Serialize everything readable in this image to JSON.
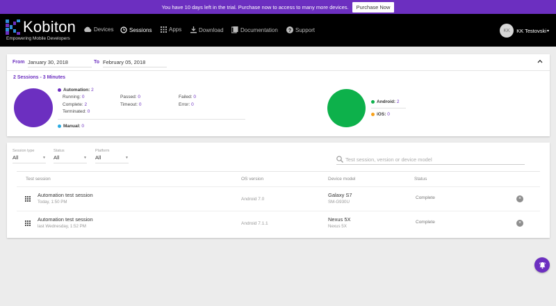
{
  "trial": {
    "message": "You have 10 days left in the trial. Purchase now to access to many more devices.",
    "button": "Purchase Now"
  },
  "brand": {
    "name": "Kobiton",
    "tagline": "Empowering Mobile Developers"
  },
  "nav": {
    "items": [
      {
        "label": "Devices",
        "icon": "cloud-icon"
      },
      {
        "label": "Sessions",
        "icon": "clock-icon",
        "active": true
      },
      {
        "label": "Apps",
        "icon": "grid-icon"
      },
      {
        "label": "Download",
        "icon": "download-icon"
      },
      {
        "label": "Documentation",
        "icon": "book-icon"
      },
      {
        "label": "Support",
        "icon": "help-icon"
      }
    ],
    "user": {
      "initials": "KK",
      "name": "KK Testovski"
    }
  },
  "date_range": {
    "from_label": "From",
    "from": "January 30, 2018",
    "to_label": "To",
    "to": "February 05, 2018"
  },
  "summary": {
    "heading": "2 Sessions - 3 Minutes",
    "automation": {
      "label": "Automation:",
      "value": "2"
    },
    "running": {
      "label": "Running:",
      "value": "0"
    },
    "complete": {
      "label": "Complete:",
      "value": "2"
    },
    "terminated": {
      "label": "Terminated:",
      "value": "0"
    },
    "passed": {
      "label": "Passed:",
      "value": "0"
    },
    "timeout": {
      "label": "Timeout:",
      "value": "0"
    },
    "failed": {
      "label": "Failed:",
      "value": "0"
    },
    "error": {
      "label": "Error:",
      "value": "0"
    },
    "manual": {
      "label": "Manual:",
      "value": "0"
    },
    "android": {
      "label": "Android:",
      "value": "2"
    },
    "ios": {
      "label": "iOS:",
      "value": "0"
    }
  },
  "colors": {
    "accent": "#6c2fc0",
    "automation": "#6c2fc0",
    "manual": "#29abe2",
    "android": "#0db14b",
    "ios": "#f7a11a"
  },
  "filters": {
    "session_type": {
      "label": "Session type",
      "value": "All"
    },
    "status": {
      "label": "Status",
      "value": "All"
    },
    "platform": {
      "label": "Platform",
      "value": "All"
    },
    "search_placeholder": "Test session, version or device model"
  },
  "table": {
    "headers": [
      "Test session",
      "OS version",
      "Device model",
      "Status"
    ],
    "rows": [
      {
        "name": "Automation test session",
        "time": "Today, 1:50 PM",
        "os": "Android 7.0",
        "device": "Galaxy S7",
        "model": "SM-G930U",
        "status": "Complete"
      },
      {
        "name": "Automation test session",
        "time": "last Wednesday, 1:52 PM",
        "os": "Android 7.1.1",
        "device": "Nexus 5X",
        "model": "Nexus 5X",
        "status": "Complete"
      }
    ]
  }
}
